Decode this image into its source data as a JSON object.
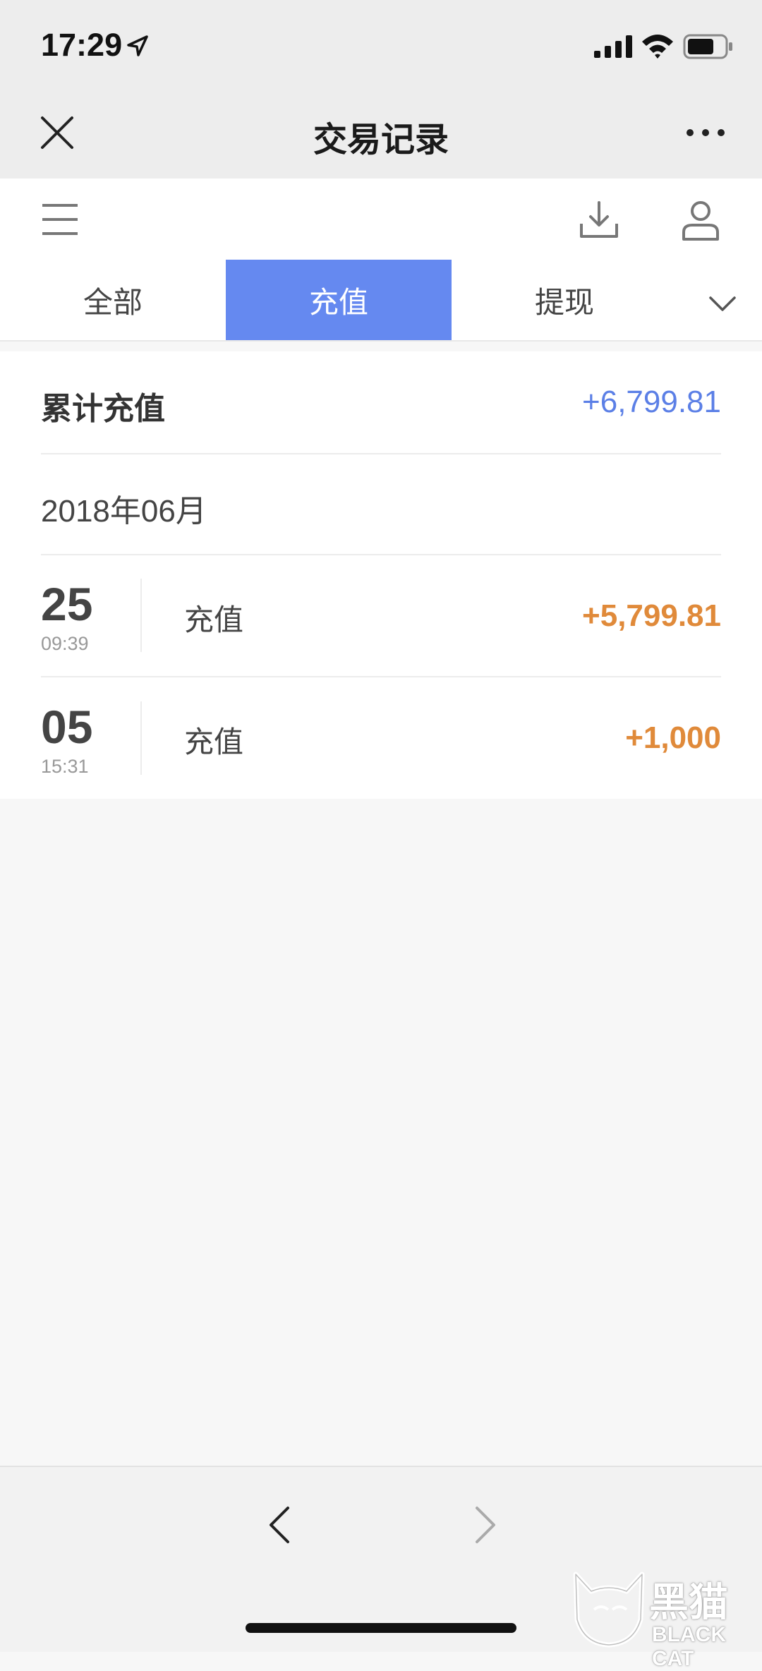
{
  "status_bar": {
    "time": "17:29"
  },
  "title_bar": {
    "title": "交易记录"
  },
  "tabs": [
    {
      "label": "全部",
      "active": false
    },
    {
      "label": "充值",
      "active": true
    },
    {
      "label": "提现",
      "active": false
    }
  ],
  "summary": {
    "label": "累计充值",
    "value": "+6,799.81"
  },
  "month_header": "2018年06月",
  "transactions": [
    {
      "day": "25",
      "time": "09:39",
      "type": "充值",
      "amount": "+5,799.81"
    },
    {
      "day": "05",
      "time": "15:31",
      "type": "充值",
      "amount": "+1,000"
    }
  ],
  "watermark": {
    "text": "黑猫",
    "sub": "BLACK CAT"
  },
  "colors": {
    "accent_tab": "#6589f0",
    "summary_value": "#5b7fe6",
    "amount": "#e08a3a"
  },
  "icons": [
    "location-arrow-icon",
    "signal-icon",
    "wifi-icon",
    "battery-icon",
    "close-icon",
    "more-icon",
    "menu-icon",
    "download-icon",
    "user-icon",
    "chevron-down-icon",
    "back-icon",
    "forward-icon",
    "cat-logo-icon"
  ]
}
